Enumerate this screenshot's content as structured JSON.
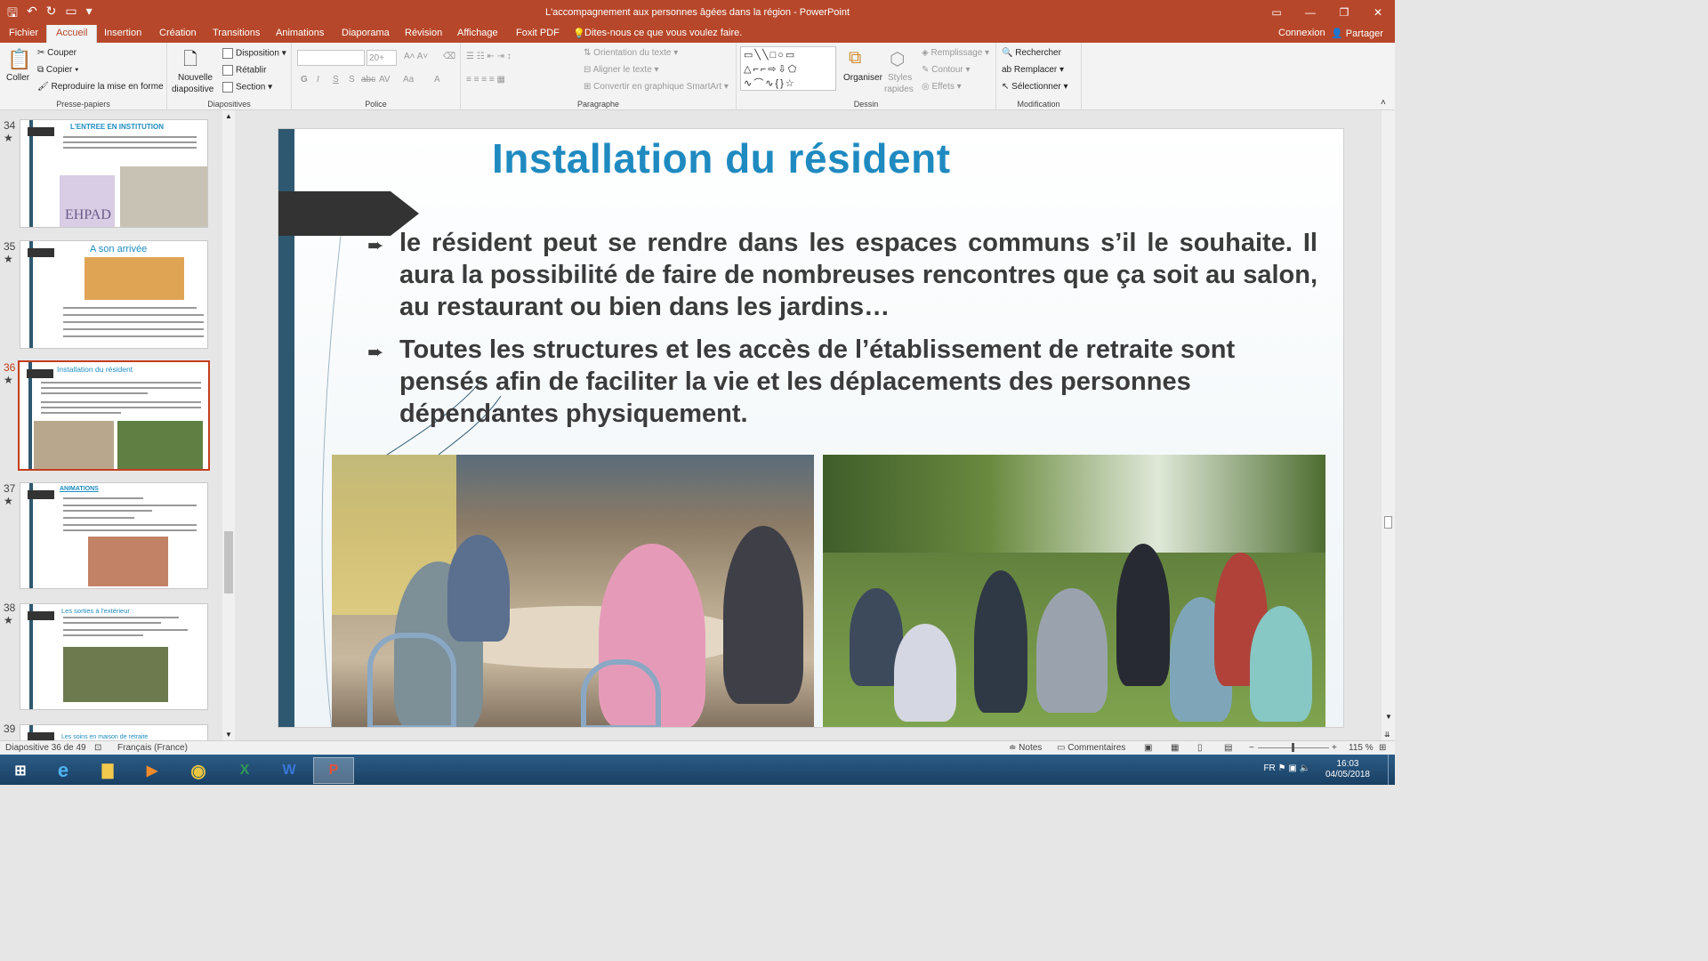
{
  "window": {
    "title": "L'accompagnement aux personnes âgées dans la région - PowerPoint",
    "signin": "Connexion",
    "share": "Partager"
  },
  "tabs": [
    "Fichier",
    "Accueil",
    "Insertion",
    "Création",
    "Transitions",
    "Animations",
    "Diaporama",
    "Révision",
    "Affichage",
    "Foxit PDF"
  ],
  "active_tab": "Accueil",
  "tell_me": "Dites-nous ce que vous voulez faire.",
  "ribbon": {
    "clipboard": {
      "label": "Presse-papiers",
      "paste": "Coller",
      "cut": "Couper",
      "copy": "Copier",
      "format_painter": "Reproduire la mise en forme"
    },
    "slides": {
      "label": "Diapositives",
      "new_slide_1": "Nouvelle",
      "new_slide_2": "diapositive",
      "layout": "Disposition",
      "reset": "Rétablir",
      "section": "Section"
    },
    "font": {
      "label": "Police",
      "size": "20+",
      "bold": "G",
      "italic": "I",
      "underline": "S",
      "shadow": "S",
      "strike": "abc",
      "spacing": "AV",
      "case": "Aa",
      "color": "A"
    },
    "paragraph": {
      "label": "Paragraphe",
      "text_direction": "Orientation du texte",
      "align_text": "Aligner le texte",
      "smartart": "Convertir en graphique SmartArt"
    },
    "drawing": {
      "label": "Dessin",
      "arrange": "Organiser",
      "styles_1": "Styles",
      "styles_2": "rapides",
      "fill": "Remplissage",
      "outline": "Contour",
      "effects": "Effets"
    },
    "editing": {
      "label": "Modification",
      "find": "Rechercher",
      "replace": "Remplacer",
      "select": "Sélectionner"
    }
  },
  "thumbnails": [
    {
      "num": "34",
      "title": "L'ENTREE EN INSTITUTION",
      "photo_caption": "EHPAD"
    },
    {
      "num": "35",
      "title": "A son arrivée"
    },
    {
      "num": "36",
      "title": "Installation du résident"
    },
    {
      "num": "37",
      "title": "ANIMATIONS"
    },
    {
      "num": "38",
      "title": "Les sorties à l'extérieur :"
    },
    {
      "num": "39",
      "title": "Les soins en maison de retraite"
    }
  ],
  "slide": {
    "title": "Installation du résident",
    "bullets": [
      " le résident peut se rendre dans les espaces communs s’il le souhaite. Il aura la possibilité de faire de nombreuses rencontres que ça soit au salon, au restaurant ou bien dans les jardins…",
      "Toutes les structures et les accès de l’établissement de retraite sont pensés afin de faciliter la vie et les déplacements des personnes dépendantes physiquement."
    ]
  },
  "status": {
    "slide_counter": "Diapositive 36 de 49",
    "language": "Français (France)",
    "notes": "Notes",
    "comments": "Commentaires",
    "zoom": "115 %"
  },
  "taskbar": {
    "lang": "FR",
    "time": "16:03",
    "date": "04/05/2018"
  }
}
